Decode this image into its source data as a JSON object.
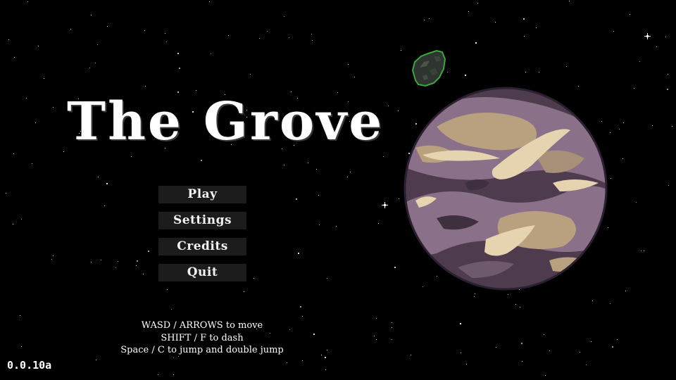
{
  "game": {
    "title": "The Grove",
    "version": "0.0.10a"
  },
  "menu": {
    "play_label": "Play",
    "settings_label": "Settings",
    "credits_label": "Credits",
    "quit_label": "Quit"
  },
  "controls": {
    "move": "WASD / ARROWS to move",
    "dash": "SHIFT / F to dash",
    "jump": "Space / C to jump and double jump"
  },
  "scene": {
    "planet_icon": "planet",
    "asteroid_icon": "asteroid",
    "colors": {
      "background": "#000000",
      "button_bg": "#1c1c1c",
      "planet_dark": "#4e3c4e",
      "planet_mid": "#8a7088",
      "planet_light": "#e6d4b0",
      "planet_tan": "#b9a07e",
      "asteroid_outline": "#3ba83b"
    }
  }
}
